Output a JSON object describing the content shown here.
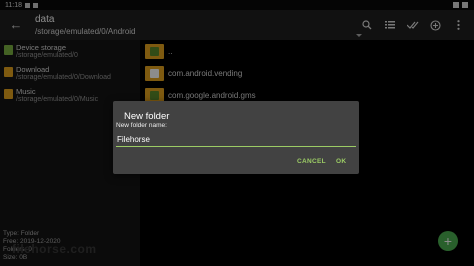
{
  "statusbar": {
    "time": "11:18"
  },
  "toolbar": {
    "title": "data",
    "path": "/storage/emulated/0/Android",
    "icons": [
      "back-arrow-icon",
      "search-icon",
      "list-view-icon",
      "select-all-icon",
      "add-icon",
      "more-vert-icon"
    ]
  },
  "storages": [
    {
      "name": "Device storage",
      "path": "/storage/emulated/0",
      "icon": "sd-card-icon"
    },
    {
      "name": "Download",
      "path": "/storage/emulated/0/Download",
      "icon": "folder-icon"
    },
    {
      "name": "Music",
      "path": "/storage/emulated/0/Music",
      "icon": "folder-icon"
    }
  ],
  "files": [
    {
      "name": ".."
    },
    {
      "name": "com.android.vending"
    },
    {
      "name": "com.google.android.gms"
    }
  ],
  "info": {
    "type": "Type: Folder",
    "created": "Free: 2019-12-2020",
    "folders": "Folders: 0",
    "size": "Size: 0B"
  },
  "watermark": "filehorse.com",
  "dialog": {
    "title": "New folder",
    "label": "New folder name:",
    "value": "Filehorse",
    "cancel": "CANCEL",
    "ok": "OK"
  },
  "colors": {
    "accent": "#9ccc65",
    "folder": "#e6a51e",
    "fab": "#4caf50"
  }
}
